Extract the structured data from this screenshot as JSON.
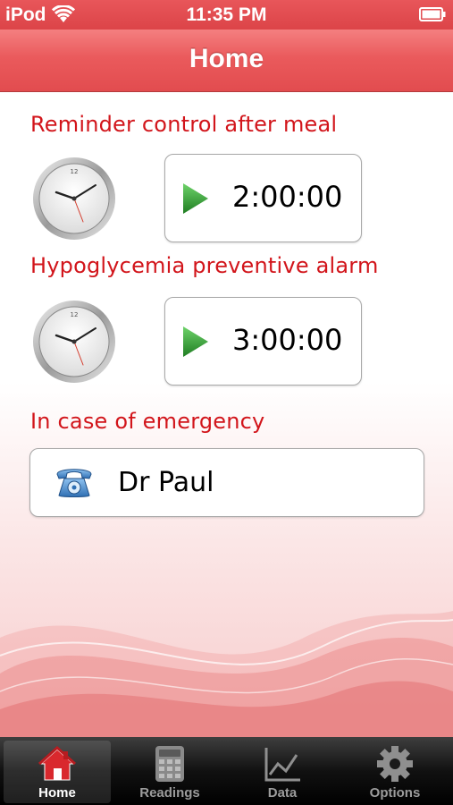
{
  "status_bar": {
    "carrier": "iPod",
    "time": "11:35 PM"
  },
  "nav": {
    "title": "Home"
  },
  "reminders": [
    {
      "label": "Reminder control after meal",
      "timer": "2:00:00"
    },
    {
      "label": "Hypoglycemia preventive alarm",
      "timer": "3:00:00"
    }
  ],
  "emergency": {
    "label": "In case of emergency",
    "contact": "Dr Paul"
  },
  "tabs": [
    {
      "label": "Home",
      "icon": "home-icon",
      "active": true
    },
    {
      "label": "Readings",
      "icon": "calculator-icon",
      "active": false
    },
    {
      "label": "Data",
      "icon": "chart-icon",
      "active": false
    },
    {
      "label": "Options",
      "icon": "gear-icon",
      "active": false
    }
  ],
  "colors": {
    "accent": "#d2151b",
    "nav": "#e85557",
    "play": "#2e9a2e"
  }
}
